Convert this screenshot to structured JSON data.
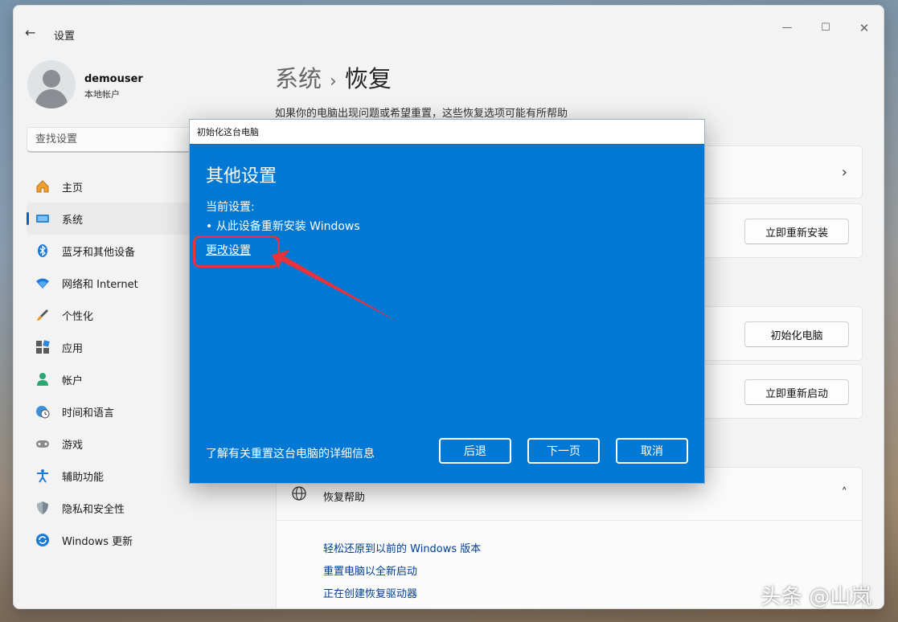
{
  "window": {
    "title": "设置",
    "back_icon": "←",
    "minimize_icon": "—",
    "maximize_icon": "☐",
    "close_icon": "✕"
  },
  "user": {
    "name": "demouser",
    "type": "本地帐户"
  },
  "search": {
    "placeholder": "查找设置"
  },
  "sidebar": {
    "items": [
      {
        "label": "主页",
        "icon": "home-icon",
        "active": false
      },
      {
        "label": "系统",
        "icon": "system-icon",
        "active": true
      },
      {
        "label": "蓝牙和其他设备",
        "icon": "bluetooth-icon",
        "active": false
      },
      {
        "label": "网络和 Internet",
        "icon": "wifi-icon",
        "active": false
      },
      {
        "label": "个性化",
        "icon": "brush-icon",
        "active": false
      },
      {
        "label": "应用",
        "icon": "apps-icon",
        "active": false
      },
      {
        "label": "帐户",
        "icon": "account-icon",
        "active": false
      },
      {
        "label": "时间和语言",
        "icon": "globe-clock-icon",
        "active": false
      },
      {
        "label": "游戏",
        "icon": "gamepad-icon",
        "active": false
      },
      {
        "label": "辅助功能",
        "icon": "accessibility-icon",
        "active": false
      },
      {
        "label": "隐私和安全性",
        "icon": "shield-icon",
        "active": false
      },
      {
        "label": "Windows 更新",
        "icon": "update-icon",
        "active": false
      }
    ]
  },
  "main": {
    "breadcrumb_parent": "系统",
    "breadcrumb_sep": "›",
    "breadcrumb_current": "恢复",
    "description": "如果你的电脑出现问题或希望重置，这些恢复选项可能有所帮助",
    "card_chevron": "›",
    "reinstall_button": "立即重新安装",
    "reset_button": "初始化电脑",
    "restart_button": "立即重新启动",
    "help": {
      "title": "恢复帮助",
      "chevron": "˄",
      "links": [
        "轻松还原到以前的 Windows 版本",
        "重置电脑以全新启动",
        "正在创建恢复驱动器"
      ]
    }
  },
  "dialog": {
    "title": "初始化这台电脑",
    "heading": "其他设置",
    "current_label": "当前设置:",
    "current_item": "• 从此设备重新安装 Windows",
    "change_link": "更改设置",
    "learn_more": "了解有关重置这台电脑的详细信息",
    "back_button": "后退",
    "next_button": "下一页",
    "cancel_button": "取消"
  },
  "annotation_color": "#e8323c",
  "watermark": "头条 @山岚"
}
